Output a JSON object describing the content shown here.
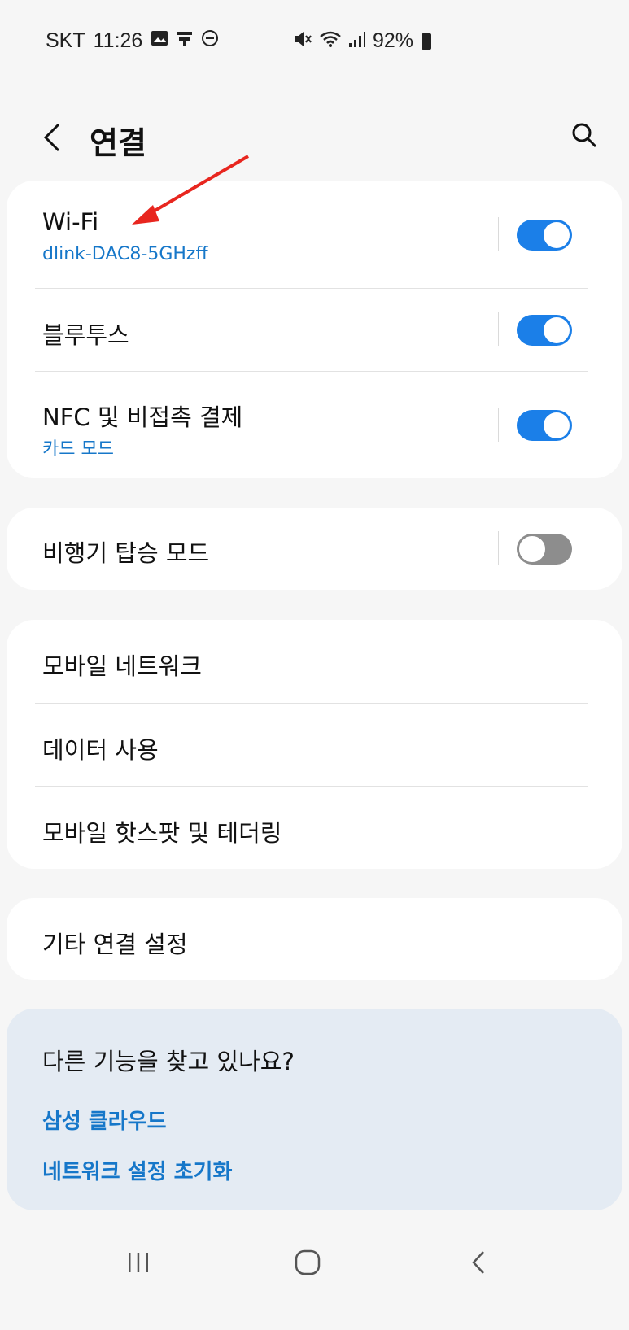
{
  "status_bar": {
    "carrier": "SKT",
    "time": "11:26",
    "battery": "92%"
  },
  "header": {
    "title": "연결"
  },
  "sections": {
    "wifi": {
      "title": "Wi-Fi",
      "subtitle": "dlink-DAC8-5GHzff",
      "toggle_on": true
    },
    "bluetooth": {
      "title": "블루투스",
      "toggle_on": true
    },
    "nfc": {
      "title": "NFC 및 비접촉 결제",
      "subtitle": "카드 모드",
      "toggle_on": true
    },
    "airplane": {
      "title": "비행기 탑승 모드",
      "toggle_on": false
    },
    "mobile_network": {
      "title": "모바일 네트워크"
    },
    "data_usage": {
      "title": "데이터 사용"
    },
    "hotspot": {
      "title": "모바일 핫스팟 및 테더링"
    },
    "more": {
      "title": "기타 연결 설정"
    }
  },
  "help": {
    "title": "다른 기능을 찾고 있나요?",
    "links": [
      "삼성 클라우드",
      "네트워크 설정 초기화"
    ]
  },
  "colors": {
    "accent": "#1b7fe8",
    "link": "#1677c9",
    "annotation_arrow": "#e8261f"
  }
}
